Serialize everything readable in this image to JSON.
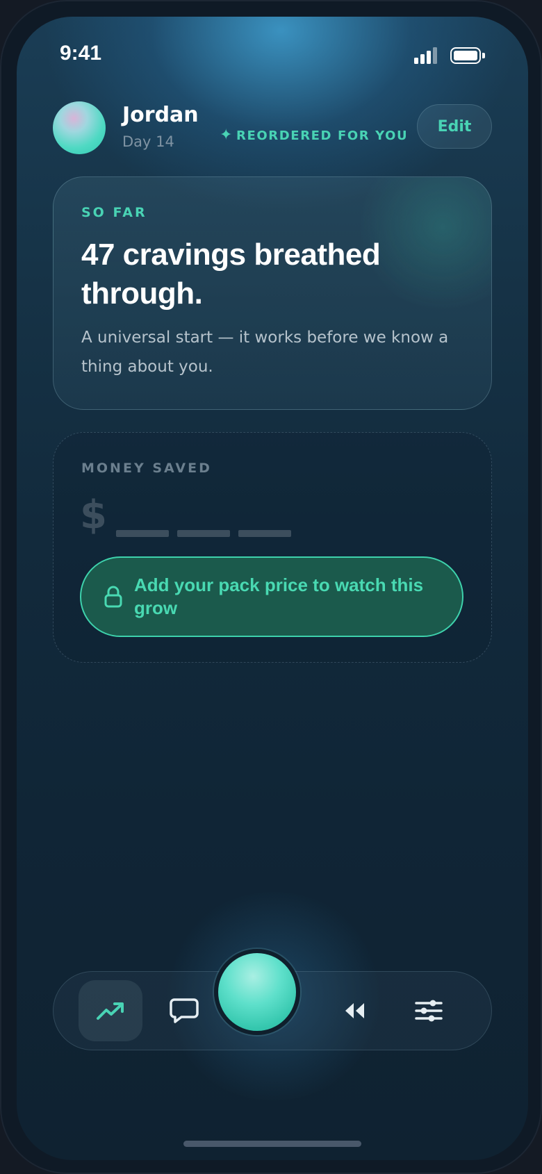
{
  "status_bar": {
    "time": "9:41",
    "signal_icon": "signal-bars-icon",
    "battery_icon": "battery-icon"
  },
  "header": {
    "user_name": "Jordan",
    "day_label": "Day 14",
    "badge_label": "REORDERED FOR YOU",
    "badge_icon": "sparkle-icon",
    "edit_label": "Edit"
  },
  "so_far_card": {
    "eyebrow": "SO FAR",
    "headline": "47 cravings breathed through.",
    "description": "A universal start — it works before we know a thing about you."
  },
  "money_card": {
    "eyebrow": "MONEY SAVED",
    "currency_symbol": "$",
    "button_label": "Add your pack price to watch this grow",
    "button_icon": "lock-icon"
  },
  "bottom_nav": {
    "items": [
      {
        "icon": "trend-up-icon",
        "active": true
      },
      {
        "icon": "chat-bubble-icon",
        "active": false
      },
      {
        "icon": "breathe-orb-icon",
        "active": false
      },
      {
        "icon": "rewind-icon",
        "active": false
      },
      {
        "icon": "sliders-icon",
        "active": false
      }
    ]
  },
  "colors": {
    "accent": "#49d3b4",
    "background": "#102536",
    "button_fill": "#1b5a4c"
  }
}
